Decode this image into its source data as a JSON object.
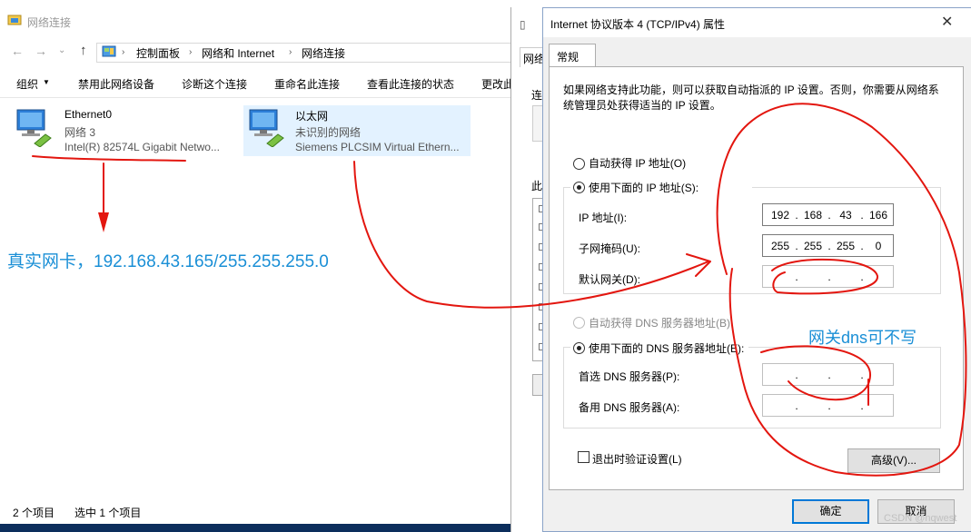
{
  "explorer": {
    "title": "网络连接",
    "address": {
      "crumbs": [
        "控制面板",
        "网络和 Internet",
        "网络连接"
      ]
    },
    "toolbar": {
      "organize": "组织",
      "disable": "禁用此网络设备",
      "diagnose": "诊断这个连接",
      "rename": "重命名此连接",
      "status": "查看此连接的状态",
      "more": "更改此"
    },
    "adapters": [
      {
        "name": "Ethernet0",
        "network": "网络  3",
        "device": "Intel(R) 82574L Gigabit Netwo..."
      },
      {
        "name": "以太网",
        "network": "未识别的网络",
        "device": "Siemens PLCSIM Virtual Ethern..."
      }
    ],
    "status": {
      "items": "2 个项目",
      "selected": "选中 1 个项目"
    }
  },
  "annotations": {
    "real_nic": "真实网卡，192.168.43.165/255.255.255.0",
    "dns_note": "网关dns可不写"
  },
  "background_window": {
    "tab": "网络",
    "frag1": "连",
    "frag2": "此"
  },
  "dialog": {
    "title": "Internet 协议版本 4 (TCP/IPv4) 属性",
    "tab": "常规",
    "intro": "如果网络支持此功能，则可以获取自动指派的 IP 设置。否则，你需要从网络系统管理员处获得适当的 IP 设置。",
    "auto_ip": "自动获得 IP 地址(O)",
    "manual_ip": "使用下面的 IP 地址(S):",
    "ip_label": "IP 地址(I):",
    "mask_label": "子网掩码(U):",
    "gateway_label": "默认网关(D):",
    "ip": [
      "192",
      "168",
      "43",
      "166"
    ],
    "mask": [
      "255",
      "255",
      "255",
      "0"
    ],
    "auto_dns": "自动获得 DNS 服务器地址(B)",
    "manual_dns": "使用下面的 DNS 服务器地址(E):",
    "dns1_label": "首选 DNS 服务器(P):",
    "dns2_label": "备用 DNS 服务器(A):",
    "validate": "退出时验证设置(L)",
    "advanced": "高级(V)...",
    "ok": "确定",
    "cancel": "取消",
    "dot": "."
  },
  "watermark": "CSDN @nqwest",
  "colors": {
    "annotation_blue": "#1a8fd6",
    "pen_red": "#e3160f",
    "selection": "#cce8ff"
  }
}
